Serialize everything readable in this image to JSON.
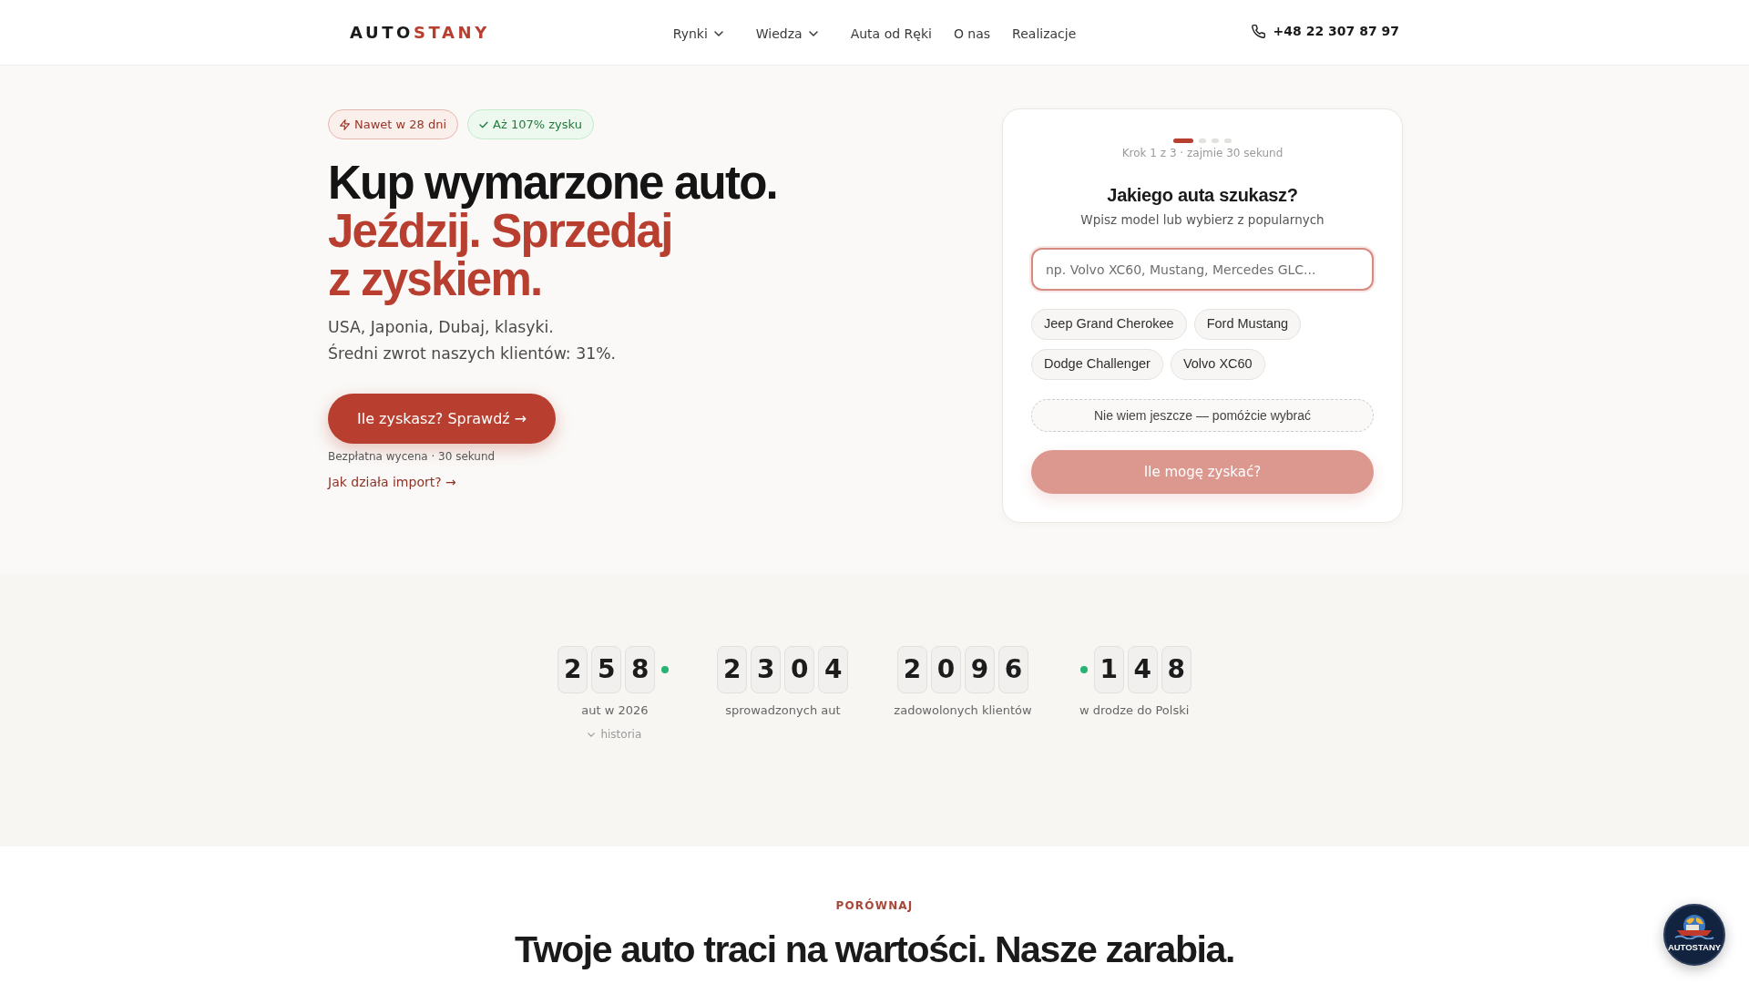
{
  "header": {
    "logo": {
      "part_1": "AUTO",
      "part_2": "STANY"
    },
    "nav": [
      {
        "label": "Rynki",
        "dropdown": true
      },
      {
        "label": "Wiedza",
        "dropdown": true
      },
      {
        "label": "Auta od Ręki",
        "dropdown": false
      },
      {
        "label": "O nas",
        "dropdown": false
      },
      {
        "label": "Realizacje",
        "dropdown": false
      }
    ],
    "phone": "+48 22 307 87 97"
  },
  "hero": {
    "badges": [
      {
        "kind": "speed",
        "label": "Nawet w 28 dni"
      },
      {
        "kind": "success",
        "label": "Aż 107% zysku"
      }
    ],
    "headline": "Kup wymarzone auto.",
    "headline_accent": "Jeździj. Sprzedaj z zyskiem.",
    "subtitle_lines": [
      "USA, Japonia, Dubaj, klasyki.",
      "Średni zwrot naszych klientów: 31%."
    ],
    "cta": "Ile zyskasz? Sprawdź →",
    "cta_note": "Bezpłatna wycena · 30 sekund",
    "link": "Jak działa import? →"
  },
  "form_card": {
    "steps": [
      {
        "active": true
      },
      {
        "active": false
      },
      {
        "active": false
      },
      {
        "active": false
      }
    ],
    "step_label": "Krok 1 z 3 · zajmie 30 sekund",
    "title": "Jakiego auta szukasz?",
    "subtitle": "Wpisz model lub wybierz z popularnych",
    "search": {
      "placeholder": "np. Volvo XC60, Mustang, Mercedes GLC...",
      "focused": true
    },
    "suggestions": [
      "Jeep Grand Cherokee",
      "Ford Mustang",
      "Dodge Challenger",
      "Volvo XC60"
    ],
    "help_button": "Nie wiem jeszcze — pomóżcie wybrać",
    "submit": {
      "label": "Ile mogę zyskać?",
      "disabled": true
    }
  },
  "stats": [
    {
      "tiles": [
        {
          "kind": "digit",
          "text": "2"
        },
        {
          "kind": "digit",
          "text": "5"
        },
        {
          "kind": "digit",
          "text": "8"
        },
        {
          "kind": "live_dot"
        }
      ],
      "label": "aut w 2026",
      "toggle": "historia"
    },
    {
      "tiles": [
        {
          "kind": "digit",
          "text": "2"
        },
        {
          "kind": "digit",
          "text": "3"
        },
        {
          "kind": "digit",
          "text": "0"
        },
        {
          "kind": "digit",
          "text": "4"
        }
      ],
      "label": "sprowadzonych aut"
    },
    {
      "tiles": [
        {
          "kind": "digit",
          "text": "2"
        },
        {
          "kind": "digit",
          "text": "0"
        },
        {
          "kind": "digit",
          "text": "9"
        },
        {
          "kind": "digit",
          "text": "6"
        }
      ],
      "label": "zadowolonych klientów"
    },
    {
      "tiles": [
        {
          "kind": "live_dot"
        },
        {
          "kind": "digit",
          "text": "1"
        },
        {
          "kind": "digit",
          "text": "4"
        },
        {
          "kind": "digit",
          "text": "8"
        }
      ],
      "label": "w drodze do Polski"
    }
  ],
  "comparison": {
    "eyebrow": "PORÓWNAJ",
    "title": "Twoje auto traci na wartości. Nasze zarabia."
  },
  "chat_widget": {
    "logo_text": "AUTOSTANY"
  }
}
